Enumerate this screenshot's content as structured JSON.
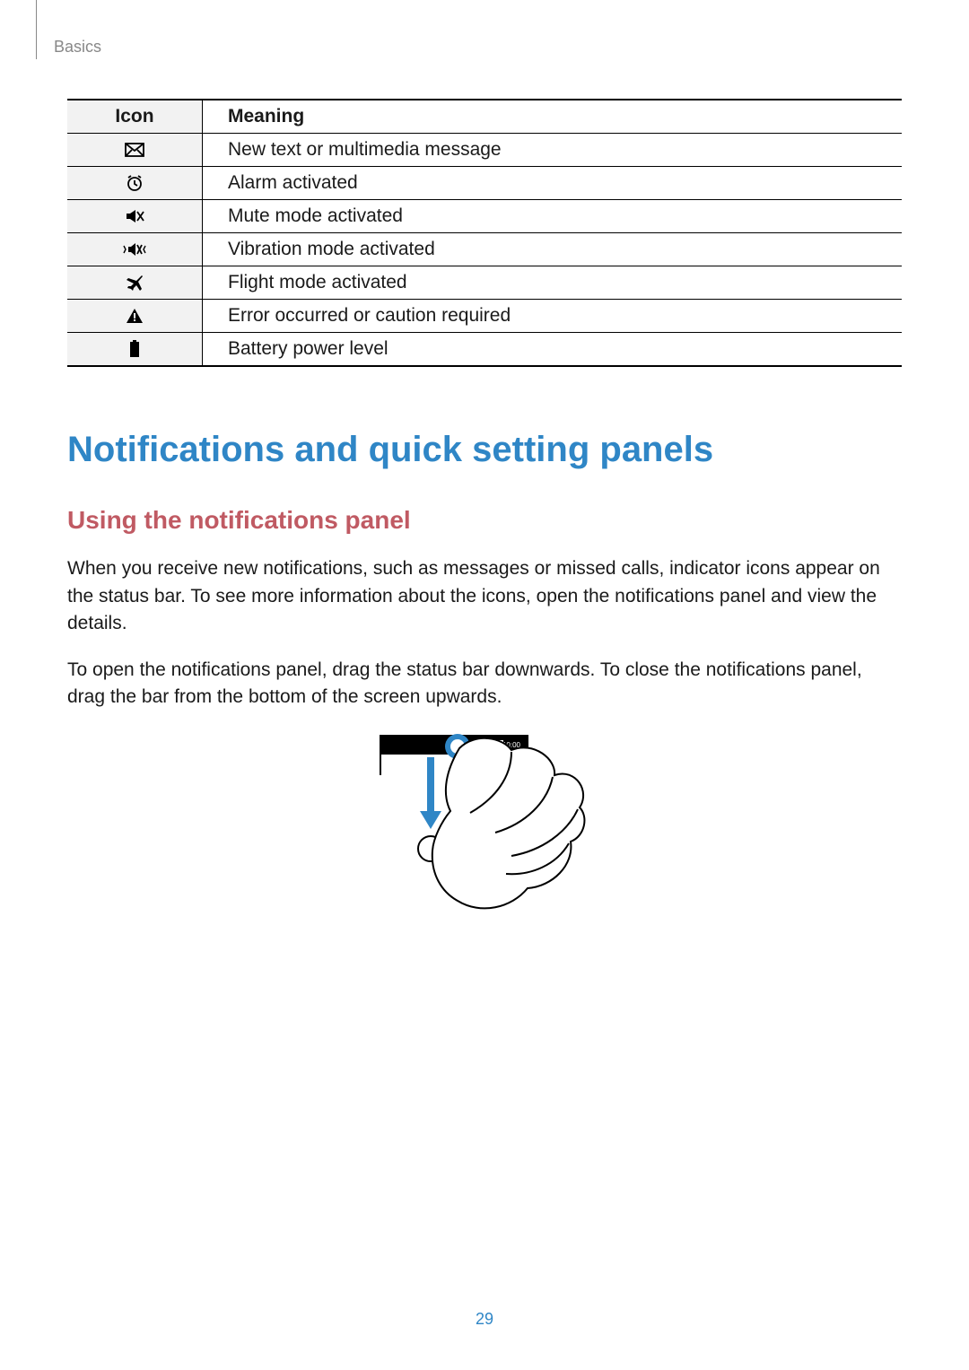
{
  "breadcrumb": "Basics",
  "table": {
    "headers": {
      "icon": "Icon",
      "meaning": "Meaning"
    },
    "rows": [
      {
        "icon_name": "message-icon",
        "meaning": "New text or multimedia message"
      },
      {
        "icon_name": "alarm-icon",
        "meaning": "Alarm activated"
      },
      {
        "icon_name": "mute-icon",
        "meaning": "Mute mode activated"
      },
      {
        "icon_name": "vibrate-icon",
        "meaning": "Vibration mode activated"
      },
      {
        "icon_name": "airplane-icon",
        "meaning": "Flight mode activated"
      },
      {
        "icon_name": "warning-icon",
        "meaning": "Error occurred or caution required"
      },
      {
        "icon_name": "battery-icon",
        "meaning": "Battery power level"
      }
    ]
  },
  "section": {
    "title": "Notifications and quick setting panels",
    "sub_title": "Using the notifications panel",
    "paragraph1": "When you receive new notifications, such as messages or missed calls, indicator icons appear on the status bar. To see more information about the icons, open the notifications panel and view the details.",
    "paragraph2": "To open the notifications panel, drag the status bar downwards. To close the notifications panel, drag the bar from the bottom of the screen upwards."
  },
  "statusbar_time": "10:00",
  "page_number": "29"
}
